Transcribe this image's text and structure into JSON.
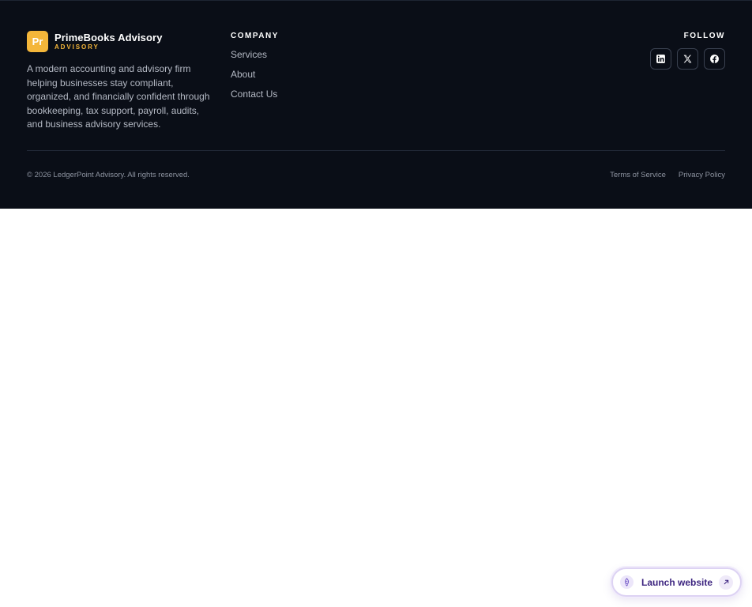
{
  "brand": {
    "logo_text": "Pr",
    "name": "PrimeBooks Advisory",
    "subtitle": "ADVISORY",
    "description": "A modern accounting and advisory firm helping businesses stay compliant, organized, and financially confident through bookkeeping, tax support, payroll, audits, and business advisory services."
  },
  "company": {
    "title": "COMPANY",
    "links": [
      {
        "label": "Services"
      },
      {
        "label": "About"
      },
      {
        "label": "Contact Us"
      }
    ]
  },
  "follow": {
    "title": "FOLLOW",
    "socials": [
      {
        "icon": "linkedin-icon"
      },
      {
        "icon": "x-twitter-icon"
      },
      {
        "icon": "facebook-icon"
      }
    ]
  },
  "bottom": {
    "copyright": "© 2026 LedgerPoint Advisory. All rights reserved.",
    "terms": "Terms of Service",
    "privacy": "Privacy Policy"
  },
  "launch": {
    "label": "Launch website",
    "logo_icon": "rocket-icon",
    "arrow_icon": "arrow-up-right-icon"
  },
  "colors": {
    "footer_bg": "#0a0e17",
    "accent": "#f4b63a",
    "text_muted": "#b4b9c4",
    "launch_text": "#3d2580"
  }
}
